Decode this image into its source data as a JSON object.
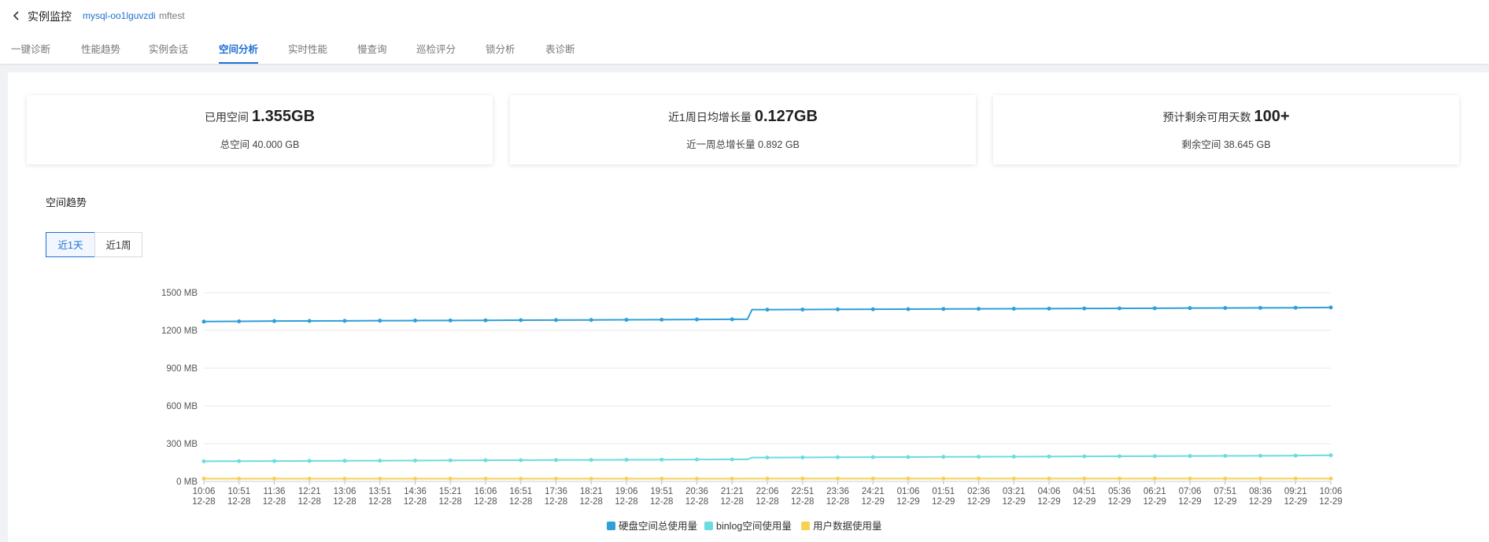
{
  "header": {
    "title": "实例监控",
    "instance_id": "mysql-oo1lguvzdi",
    "instance_tag": "mftest"
  },
  "tabs": [
    {
      "label": "一键诊断"
    },
    {
      "label": "性能趋势"
    },
    {
      "label": "实例会话"
    },
    {
      "label": "空间分析"
    },
    {
      "label": "实时性能"
    },
    {
      "label": "慢查询"
    },
    {
      "label": "巡检评分"
    },
    {
      "label": "锁分析"
    },
    {
      "label": "表诊断"
    }
  ],
  "active_tab": 3,
  "cards": [
    {
      "label": "已用空间",
      "value": "1.355GB",
      "sub": "总空间 40.000 GB"
    },
    {
      "label": "近1周日均增长量",
      "value": "0.127GB",
      "sub": "近一周总增长量 0.892 GB"
    },
    {
      "label": "预计剩余可用天数",
      "value": "100+",
      "sub": "剩余空间 38.645 GB"
    }
  ],
  "section_title": "空间趋势",
  "range_buttons": [
    {
      "label": "近1天",
      "active": true
    },
    {
      "label": "近1周",
      "active": false
    }
  ],
  "colors": {
    "accent": "#1f6fd1",
    "disk": "#2e9fd8",
    "binlog": "#6bdce0",
    "user": "#f7d154"
  },
  "chart_data": {
    "type": "line",
    "ylim": [
      0,
      1500
    ],
    "yticks": [
      "0 MB",
      "300 MB",
      "600 MB",
      "900 MB",
      "1200 MB",
      "1500 MB"
    ],
    "x": [
      [
        "10:06",
        "12-28"
      ],
      [
        "10:51",
        "12-28"
      ],
      [
        "11:36",
        "12-28"
      ],
      [
        "12:21",
        "12-28"
      ],
      [
        "13:06",
        "12-28"
      ],
      [
        "13:51",
        "12-28"
      ],
      [
        "14:36",
        "12-28"
      ],
      [
        "15:21",
        "12-28"
      ],
      [
        "16:06",
        "12-28"
      ],
      [
        "16:51",
        "12-28"
      ],
      [
        "17:36",
        "12-28"
      ],
      [
        "18:21",
        "12-28"
      ],
      [
        "19:06",
        "12-28"
      ],
      [
        "19:51",
        "12-28"
      ],
      [
        "20:36",
        "12-28"
      ],
      [
        "21:21",
        "12-28"
      ],
      [
        "22:06",
        "12-28"
      ],
      [
        "22:51",
        "12-28"
      ],
      [
        "23:36",
        "12-28"
      ],
      [
        "24:21",
        "12-29"
      ],
      [
        "01:06",
        "12-29"
      ],
      [
        "01:51",
        "12-29"
      ],
      [
        "02:36",
        "12-29"
      ],
      [
        "03:21",
        "12-29"
      ],
      [
        "04:06",
        "12-29"
      ],
      [
        "04:51",
        "12-29"
      ],
      [
        "05:36",
        "12-29"
      ],
      [
        "06:21",
        "12-29"
      ],
      [
        "07:06",
        "12-29"
      ],
      [
        "07:51",
        "12-29"
      ],
      [
        "08:36",
        "12-29"
      ],
      [
        "09:21",
        "12-29"
      ],
      [
        "10:06",
        "12-29"
      ]
    ],
    "series": [
      {
        "name": "硬盘空间总使用量",
        "color": "#2e9fd8",
        "values": [
          1270,
          1272,
          1274,
          1275,
          1276,
          1277,
          1278,
          1279,
          1280,
          1281,
          1282,
          1283,
          1284,
          1285,
          1287,
          1288,
          1365,
          1366,
          1367,
          1368,
          1369,
          1370,
          1371,
          1372,
          1373,
          1374,
          1375,
          1376,
          1377,
          1378,
          1379,
          1380,
          1382
        ]
      },
      {
        "name": "binlog空间使用量",
        "color": "#6bdce0",
        "values": [
          160,
          161,
          162,
          163,
          164,
          165,
          166,
          167,
          168,
          169,
          170,
          171,
          172,
          173,
          174,
          175,
          190,
          191,
          192,
          193,
          194,
          195,
          196,
          197,
          198,
          199,
          200,
          201,
          202,
          203,
          204,
          205,
          208
        ]
      },
      {
        "name": "用户数据使用量",
        "color": "#f7d154",
        "values": [
          22,
          22,
          22,
          22,
          22,
          22,
          22,
          22,
          22,
          22,
          22,
          22,
          22,
          22,
          22,
          22,
          23,
          23,
          23,
          23,
          23,
          23,
          23,
          23,
          23,
          23,
          23,
          23,
          23,
          23,
          23,
          23,
          23
        ]
      }
    ]
  }
}
